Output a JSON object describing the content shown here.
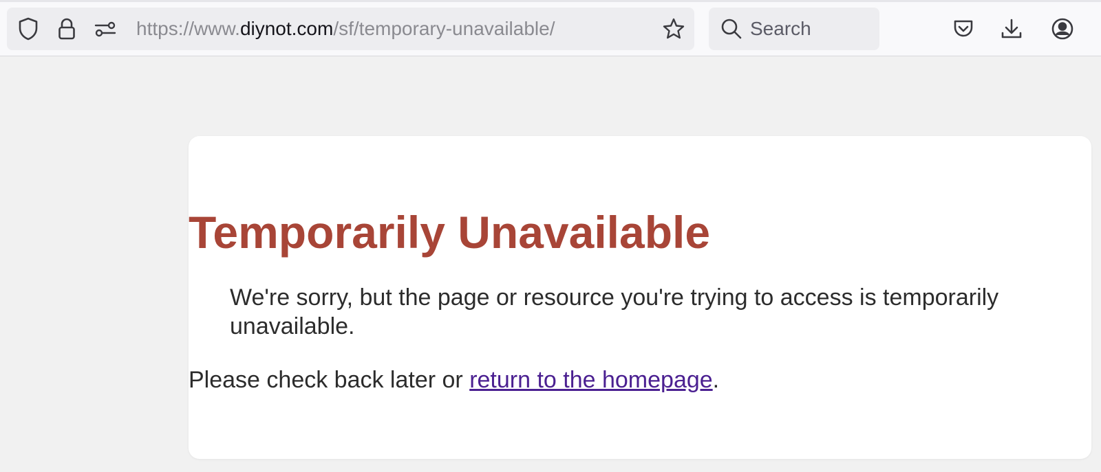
{
  "browser": {
    "url_prefix": "https://www.",
    "url_host": "diynot.com",
    "url_path": "/sf/temporary-unavailable/",
    "search_placeholder": "Search",
    "icons": [
      "shield-icon",
      "lock-icon",
      "permissions-icon",
      "bookmark-star-icon",
      "search-icon",
      "pocket-icon",
      "download-icon",
      "account-icon"
    ]
  },
  "page": {
    "title": "Temporarily Unavailable",
    "message": "We're sorry, but the page or resource you're trying to access is temporarily unavailable.",
    "cta_prefix": "Please check back later or ",
    "cta_link": "return to the homepage",
    "cta_suffix": "."
  },
  "colors": {
    "title": "#a84537",
    "link": "#4b2091",
    "background": "#f1f1f1",
    "card": "#ffffff"
  }
}
